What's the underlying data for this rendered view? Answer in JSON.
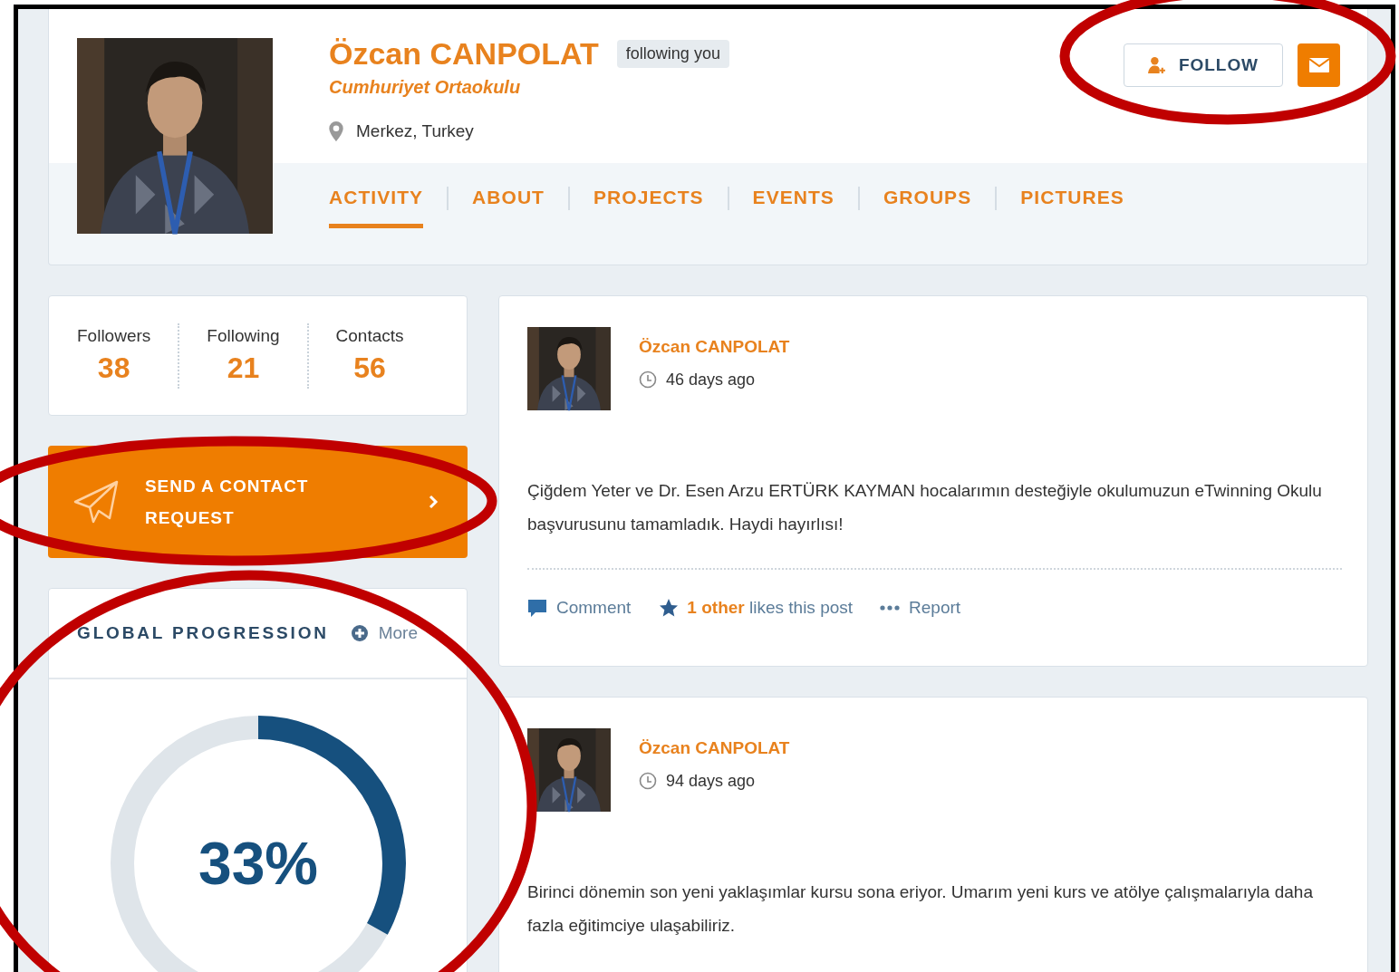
{
  "profile": {
    "name": "Özcan CANPOLAT",
    "badge": "following you",
    "school": "Cumhuriyet Ortaokulu",
    "location": "Merkez, Turkey",
    "follow_button": "FOLLOW",
    "tabs": [
      {
        "label": "ACTIVITY",
        "selected": true
      },
      {
        "label": "ABOUT",
        "selected": false
      },
      {
        "label": "PROJECTS",
        "selected": false
      },
      {
        "label": "EVENTS",
        "selected": false
      },
      {
        "label": "GROUPS",
        "selected": false
      },
      {
        "label": "PICTURES",
        "selected": false
      }
    ]
  },
  "stats": [
    {
      "label": "Followers",
      "value": "38"
    },
    {
      "label": "Following",
      "value": "21"
    },
    {
      "label": "Contacts",
      "value": "56"
    }
  ],
  "contact_button": "SEND A CONTACT REQUEST",
  "progression": {
    "title": "GLOBAL PROGRESSION",
    "more": "More",
    "value": "33%",
    "level": 0.33
  },
  "posts": [
    {
      "author": "Özcan CANPOLAT",
      "time": "46 days ago",
      "text": "Çiğdem Yeter ve Dr. Esen Arzu ERTÜRK KAYMAN hocalarımın desteğiyle okulumuzun eTwinning Okulu başvurusunu tamamladık. Haydi hayırlısı!",
      "actions": {
        "comment": "Comment",
        "likes": "**1 other** likes this post",
        "report": "Report"
      }
    },
    {
      "author": "Özcan CANPOLAT",
      "time": "94 days ago",
      "text": "Birinci dönemin son yeni yaklaşımlar kursu sona eriyor. Umarım yeni kurs ve atölye çalışmalarıyla daha fazla eğitimciye ulaşabiliriz."
    }
  ]
}
